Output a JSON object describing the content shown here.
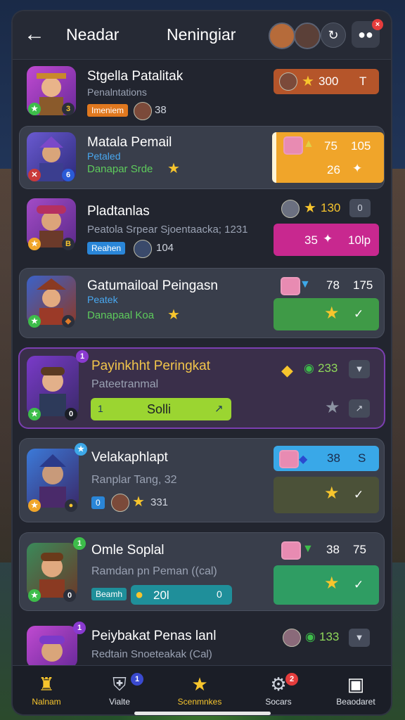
{
  "header": {
    "left_title": "Neadar",
    "center_title": "Neningiar",
    "menu_badge": "×"
  },
  "rows": [
    {
      "name": "Stgella Patalitak",
      "subtitle": "Penalntations",
      "tag": "Imeniem",
      "count": "38",
      "stat_value": "300",
      "stat_icon": "T",
      "colors": {
        "stat_box": "#b5552a"
      }
    },
    {
      "name": "Matala Pemail",
      "subtitle": "Petaled",
      "subtitle2": "Danapar Srde",
      "box_top_left": "75",
      "box_top_right": "105",
      "box_bottom": "26",
      "colors": {
        "box": "#f0a52a"
      }
    },
    {
      "name": "Pladtanlas",
      "subtitle": "Peatola Srpear Sjoentaacka; 1231",
      "tag": "Reahen",
      "count": "104",
      "stat_value": "130",
      "stat_right": "0",
      "box_left": "35",
      "box_right": "10lp",
      "colors": {
        "box": "#c8288f"
      }
    },
    {
      "name": "Gatumailoal Peingasn",
      "subtitle": "Peatek",
      "subtitle2": "Danapaal Koa",
      "top_left": "78",
      "top_right": "175",
      "colors": {
        "box": "#3f9a47"
      }
    },
    {
      "name": "Payinkhht Peringkat",
      "subtitle": "Pateetranmal",
      "bar_label": "Solli",
      "bar_left": "1",
      "top_value": "233",
      "colors": {
        "bar": "#9bd531"
      }
    },
    {
      "name": "Velakaphlapt",
      "subtitle": "Ranplar Tang, 32",
      "count_left": "0",
      "count": "331",
      "box_top": "38",
      "box_top_right": "S",
      "colors": {
        "box_top": "#39a8e8",
        "box": "#4b5138"
      }
    },
    {
      "name": "Omle Soplal",
      "subtitle": "Ramdan pn Peman ((cal)",
      "tag": "Beamh",
      "count": "20l",
      "count_end": "0",
      "top_left": "38",
      "top_right": "75",
      "colors": {
        "box": "#2f9d63"
      }
    },
    {
      "name": "Peiybakat Penas lanl",
      "subtitle": "Redtain Snoeteakak (Cal)",
      "top_value": "133"
    }
  ],
  "nav": [
    {
      "label": "Nalnam",
      "icon": "castle-icon"
    },
    {
      "label": "Vialte",
      "icon": "shield-icon",
      "badge": "1"
    },
    {
      "label": "Scenmnkes",
      "icon": "star-icon"
    },
    {
      "label": "Socars",
      "icon": "gear-icon",
      "badge": "2"
    },
    {
      "label": "Beaodaret",
      "icon": "bag-icon"
    }
  ]
}
